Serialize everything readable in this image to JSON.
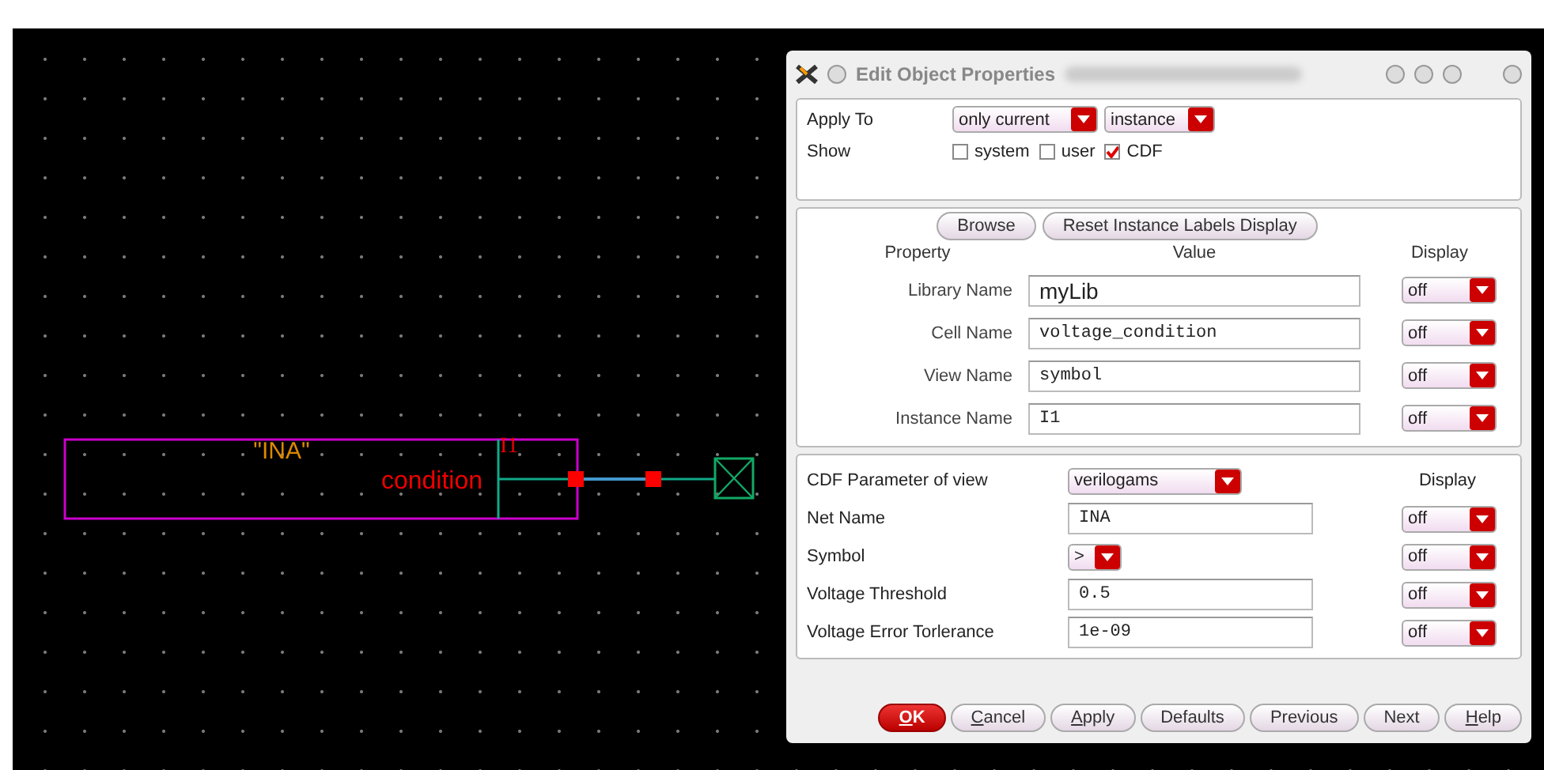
{
  "schematic": {
    "net_label": "\"INA\"",
    "pin_label": "condition",
    "instance_name": "I1"
  },
  "dialog": {
    "title": "Edit Object Properties",
    "apply_to": {
      "label": "Apply To",
      "scope": "only current",
      "target": "instance"
    },
    "show": {
      "label": "Show",
      "options": [
        {
          "label": "system",
          "checked": false
        },
        {
          "label": "user",
          "checked": false
        },
        {
          "label": "CDF",
          "checked": true
        }
      ]
    },
    "buttons": [
      "Browse",
      "Reset Instance Labels Display"
    ],
    "columns": [
      "Property",
      "Value",
      "Display"
    ],
    "properties": [
      {
        "name": "Library Name",
        "value": "myLib",
        "display": "off",
        "kind": "plain"
      },
      {
        "name": "Cell Name",
        "value": "voltage_condition",
        "display": "off",
        "kind": "mono"
      },
      {
        "name": "View Name",
        "value": "symbol",
        "display": "off",
        "kind": "mono"
      },
      {
        "name": "Instance Name",
        "value": "I1",
        "display": "off",
        "kind": "mono"
      }
    ],
    "cdf": {
      "label": "CDF Parameter of view",
      "view": "verilogams",
      "display_header": "Display",
      "params": [
        {
          "name": "Net Name",
          "kind": "input",
          "value": "INA",
          "display": "off"
        },
        {
          "name": "Symbol",
          "kind": "dropdown",
          "value": ">",
          "display": "off"
        },
        {
          "name": "Voltage Threshold",
          "kind": "input",
          "value": "0.5",
          "display": "off"
        },
        {
          "name": "Voltage Error Torlerance",
          "kind": "input",
          "value": "1e-09",
          "display": "off"
        }
      ]
    },
    "actions": [
      {
        "mnemonic": "O",
        "rest": "K",
        "kind": "default"
      },
      {
        "mnemonic": "C",
        "rest": "ancel",
        "kind": "normal"
      },
      {
        "mnemonic": "A",
        "rest": "pply",
        "kind": "normal"
      },
      {
        "rest": "Defaults",
        "kind": "normal"
      },
      {
        "rest": "Previous",
        "kind": "normal"
      },
      {
        "rest": "Next",
        "kind": "normal"
      },
      {
        "mnemonic": "H",
        "rest": "elp",
        "kind": "normal"
      }
    ]
  }
}
